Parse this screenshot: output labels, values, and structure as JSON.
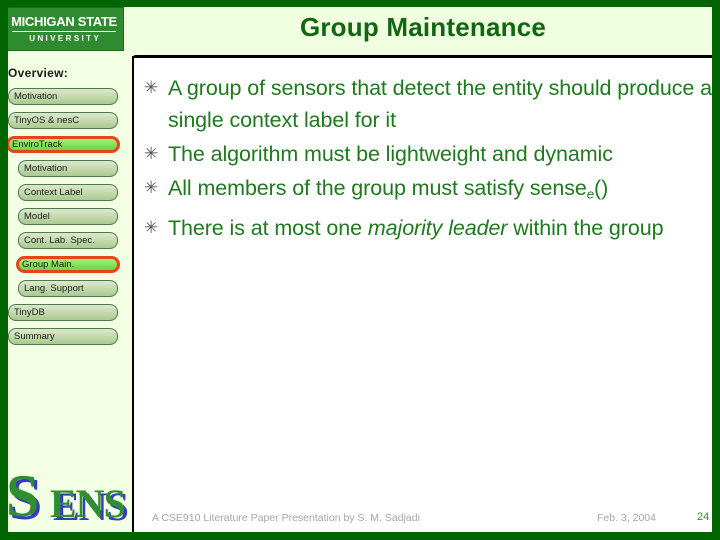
{
  "slide": {
    "title": "Group Maintenance"
  },
  "logo": {
    "msu_top": "MICHIGAN STATE",
    "msu_bottom": "UNIVERSITY",
    "sens_first": "S",
    "sens_rest": "ENS"
  },
  "sidebar": {
    "heading": "Overview:",
    "items": [
      {
        "label": "Motivation",
        "level": 0,
        "active": false
      },
      {
        "label": "TinyOS & nesC",
        "level": 0,
        "active": false
      },
      {
        "label": "EnviroTrack",
        "level": 0,
        "active": true
      },
      {
        "label": "Motivation",
        "level": 1,
        "active": false
      },
      {
        "label": "Context Label",
        "level": 1,
        "active": false
      },
      {
        "label": "Model",
        "level": 1,
        "active": false
      },
      {
        "label": "Cont. Lab. Spec.",
        "level": 1,
        "active": false
      },
      {
        "label": "Group Main.",
        "level": 1,
        "active": true
      },
      {
        "label": "Lang. Support",
        "level": 1,
        "active": false
      },
      {
        "label": "TinyDB",
        "level": 0,
        "active": false
      },
      {
        "label": "Summary",
        "level": 0,
        "active": false
      }
    ]
  },
  "content": {
    "bullet_glyph": "✳",
    "bullets": [
      {
        "parts": [
          {
            "text": "A group of sensors that detect the entity should produce a single context label for it",
            "style": "normal"
          }
        ]
      },
      {
        "parts": [
          {
            "text": "The algorithm must be lightweight and dynamic",
            "style": "normal"
          }
        ]
      },
      {
        "parts": [
          {
            "text": "All members of the group must satisfy sense",
            "style": "normal"
          },
          {
            "text": "e",
            "style": "sub"
          },
          {
            "text": "()",
            "style": "normal"
          }
        ]
      },
      {
        "parts": [
          {
            "text": "There is at most one ",
            "style": "normal"
          },
          {
            "text": "majority leader",
            "style": "italic"
          },
          {
            "text": " within the group",
            "style": "normal"
          }
        ]
      }
    ]
  },
  "footer": {
    "note": "A CSE910 Literature Paper Presentation by S. M. Sadjadi",
    "date": "Feb. 3, 2004",
    "page": "24"
  },
  "colors": {
    "frame_green": "#006400",
    "title_green": "#116611",
    "body_green": "#1f7a1f",
    "highlight_border": "#e8431a",
    "highlight_fill": "#82e05a",
    "sidebar_bg": "#f2ffe2",
    "header_bg": "#f0ffe0",
    "footer_gray": "#a6a6a6"
  }
}
